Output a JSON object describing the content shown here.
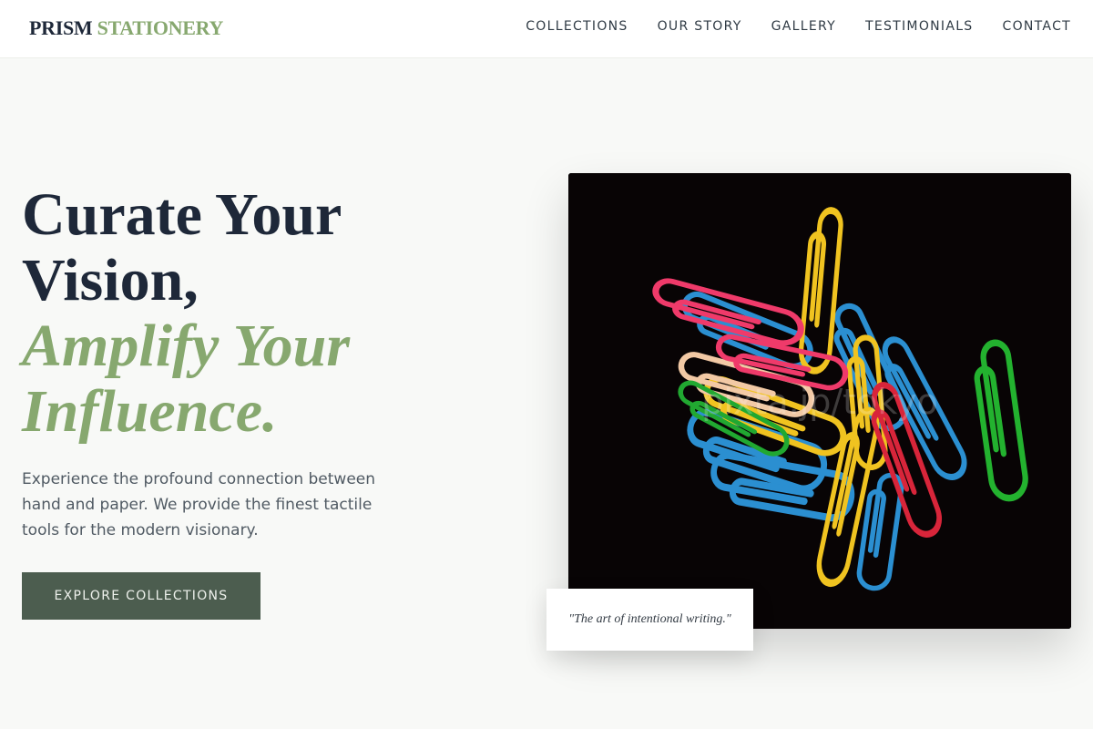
{
  "brand": {
    "part1": "PRISM",
    "part2": "STATIONERY",
    "accent_color": "#87a86f",
    "text_color": "#1e2839"
  },
  "nav": {
    "items": [
      {
        "label": "COLLECTIONS"
      },
      {
        "label": "OUR STORY"
      },
      {
        "label": "GALLERY"
      },
      {
        "label": "TESTIMONIALS"
      },
      {
        "label": "CONTACT"
      }
    ]
  },
  "hero": {
    "title_line1": "Curate Your Vision,",
    "title_line2": "Amplify Your Influence.",
    "description": "Experience the profound connection between hand and paper. We provide the finest tactile tools for the modern visionary.",
    "cta_label": "EXPLORE COLLECTIONS",
    "cta_color": "#4c5d4f"
  },
  "image": {
    "subject": "colorful paper clips on black background",
    "watermark": "pixta.jp/tokyo",
    "caption": "\"The art of intentional writing.\""
  }
}
